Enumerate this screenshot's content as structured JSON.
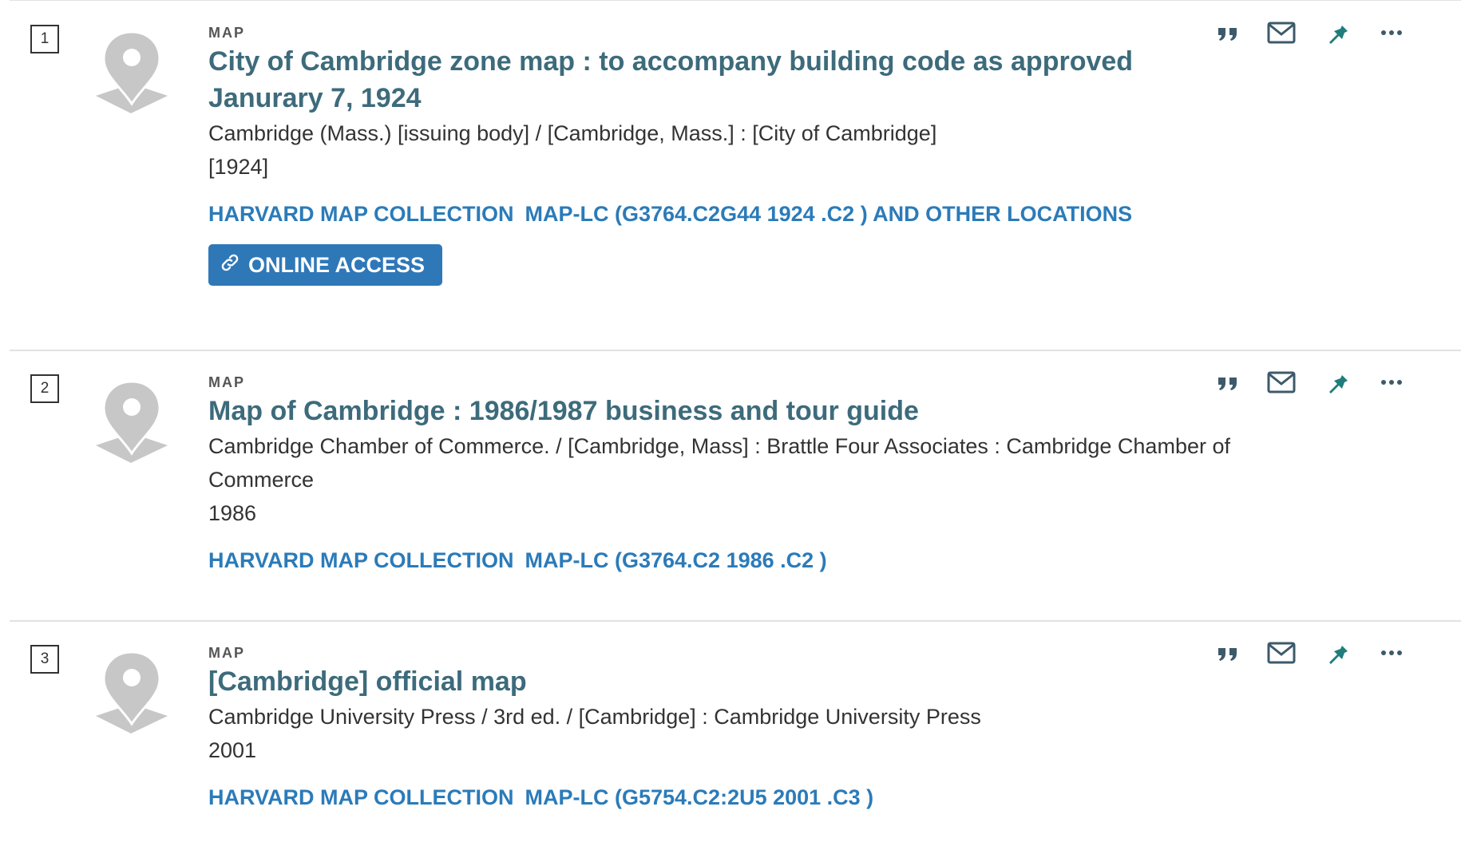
{
  "results": [
    {
      "number": "1",
      "type": "MAP",
      "title": "City of Cambridge zone map : to accompany building code as approved Janurary 7, 1924",
      "lines": [
        "Cambridge (Mass.) [issuing body] / [Cambridge, Mass.] : [City of Cambridge]",
        "[1924]"
      ],
      "availability": {
        "location": "HARVARD MAP COLLECTION",
        "call_number": "MAP-LC (G3764.C2G44 1924 .C2 ) AND OTHER LOCATIONS"
      },
      "online_access": "ONLINE ACCESS"
    },
    {
      "number": "2",
      "type": "MAP",
      "title": "Map of Cambridge : 1986/1987 business and tour guide",
      "lines": [
        "Cambridge Chamber of Commerce. / [Cambridge, Mass] : Brattle Four Associates : Cambridge Chamber of Commerce",
        "1986"
      ],
      "availability": {
        "location": "HARVARD MAP COLLECTION",
        "call_number": "MAP-LC (G3764.C2 1986 .C2 )"
      }
    },
    {
      "number": "3",
      "type": "MAP",
      "title": "[Cambridge] official map",
      "lines": [
        "Cambridge University Press / 3rd ed. / [Cambridge] : Cambridge University Press",
        "2001"
      ],
      "availability": {
        "location": "HARVARD MAP COLLECTION",
        "call_number": "MAP-LC (G5754.C2:2U5 2001 .C3 )"
      }
    }
  ],
  "icons": {
    "thumbnail": "map-pin-icon",
    "citation": "quote-icon",
    "email": "envelope-icon",
    "pin": "pushpin-icon",
    "more": "ellipsis-icon",
    "link": "link-icon"
  },
  "colors": {
    "title": "#3d6b7b",
    "availability": "#2b7bb9",
    "button": "#2f78b8",
    "pin": "#1f7d7d",
    "icon": "#3d5a6a",
    "thumbnail": "#c7c7c7"
  }
}
